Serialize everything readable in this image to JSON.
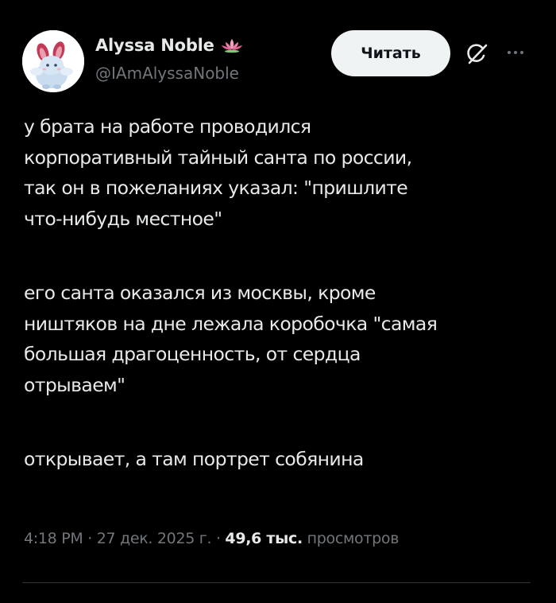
{
  "author": {
    "display_name": "Alyssa Noble",
    "handle": "@IAmAlyssaNoble",
    "badge_icon": "lotus-emoji"
  },
  "actions": {
    "read_label": "Читать",
    "grok_icon": "grok-icon",
    "more_icon": "more-icon"
  },
  "tweet": {
    "paragraphs": [
      {
        "lines": [
          "у брата на работе проводился",
          "корпоративный тайный санта по россии,",
          "так он в пожеланиях указал: \"пришлите",
          "что-нибудь местное\""
        ]
      },
      {
        "lines": [
          "его санта оказался из москвы, кроме",
          "ништяков на дне лежала коробочка \"самая",
          "большая драгоценность, от сердца",
          "отрываем\""
        ]
      },
      {
        "lines": [
          "открывает, а там портрет собянина"
        ]
      }
    ]
  },
  "meta": {
    "time": "4:18 PM",
    "separator": " · ",
    "date": "27 дек. 2025 г.",
    "views_count": "49,6 тыс.",
    "views_label": "просмотров"
  },
  "colors": {
    "background": "#000000",
    "text_primary": "#e7e9ea",
    "text_secondary": "#71767b",
    "button_bg": "#eff3f4",
    "button_text": "#0f1419",
    "divider": "#2f3336"
  }
}
